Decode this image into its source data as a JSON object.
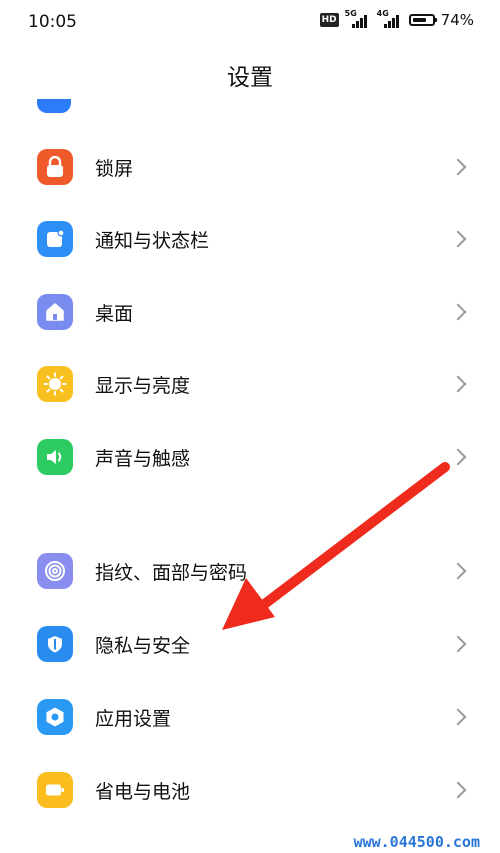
{
  "status_bar": {
    "time": "10:05",
    "hd_label": "HD",
    "net1": "5G",
    "net2": "4G",
    "battery_level": 0.74,
    "battery_text": "74%"
  },
  "header": {
    "title": "设置"
  },
  "settings": {
    "items": [
      {
        "label": "锁屏",
        "icon": "lock-icon",
        "color": "#f05a2a"
      },
      {
        "label": "通知与状态栏",
        "icon": "notification-icon",
        "color": "#2d8ff5"
      },
      {
        "label": "桌面",
        "icon": "home-icon",
        "color": "#7a8cf0"
      },
      {
        "label": "显示与亮度",
        "icon": "sun-icon",
        "color": "#f9c11f"
      },
      {
        "label": "声音与触感",
        "icon": "speaker-icon",
        "color": "#2ecb62"
      },
      {
        "label": "指纹、面部与密码",
        "icon": "fingerprint-icon",
        "color": "#8a8df0"
      },
      {
        "label": "隐私与安全",
        "icon": "shield-icon",
        "color": "#2b8cf0"
      },
      {
        "label": "应用设置",
        "icon": "app-settings-icon",
        "color": "#2a99f5"
      },
      {
        "label": "省电与电池",
        "icon": "battery-icon",
        "color": "#fbbd1e"
      }
    ]
  },
  "annotation": {
    "arrow_color": "#ee2b1d"
  },
  "watermark": "www.044500.com"
}
